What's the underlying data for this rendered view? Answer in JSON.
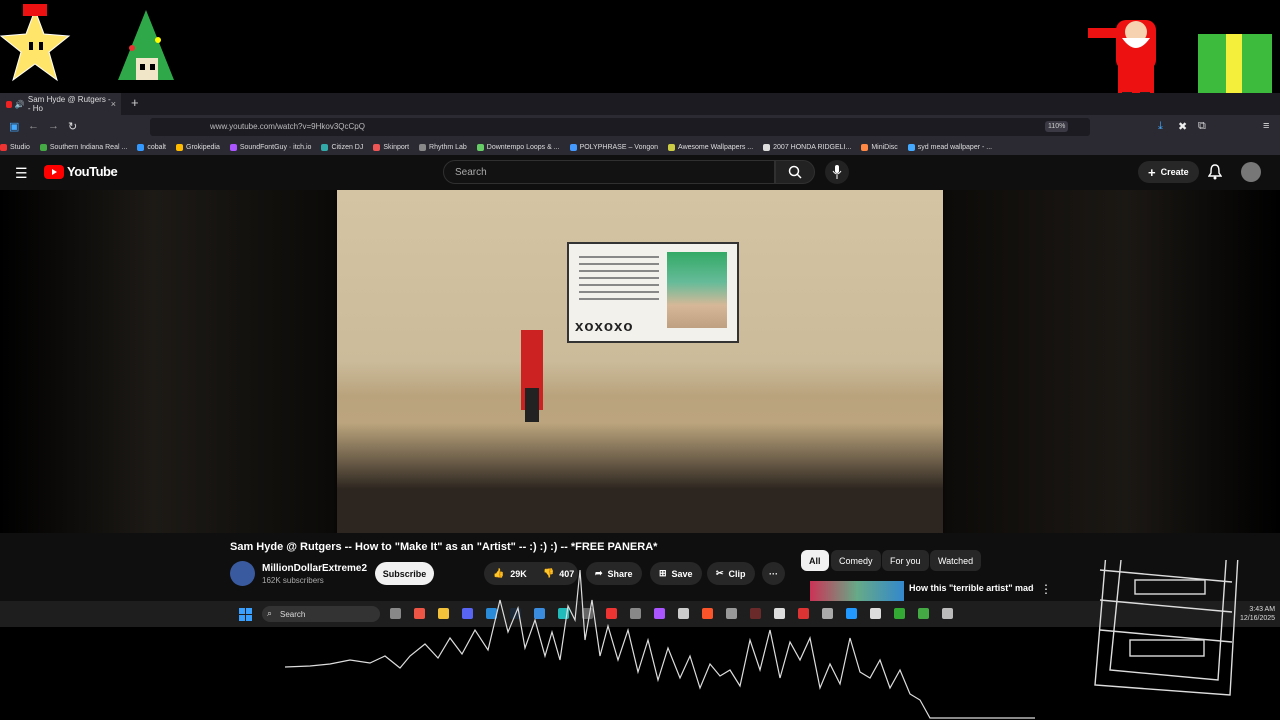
{
  "browser": {
    "tab_title": "Sam Hyde @ Rutgers -- Ho",
    "tab_close": "×",
    "new_tab": "+",
    "url": "www.youtube.com/watch?v=9Hkov3QcCpQ",
    "zoom": "110%",
    "bookmarks": [
      "Studio",
      "Southern Indiana Real ...",
      "cobalt",
      "Grokipedia",
      "SoundFontGuy · itch.io",
      "Citizen DJ",
      "Skinport",
      "Rhythm Lab",
      "Downtempo Loops & ...",
      "POLYPHRASE – Vongon",
      "Awesome Wallpapers ...",
      "2007 HONDA RIDGELI...",
      "MiniDisc",
      "syd mead wallpaper - ..."
    ]
  },
  "youtube": {
    "logo_text": "YouTube",
    "search_placeholder": "Search",
    "create_label": "Create"
  },
  "video": {
    "screen_text": "xoxoxo",
    "title": "Sam Hyde @ Rutgers -- How to \"Make It\" as an \"Artist\" -- :) :) :) -- *FREE PANERA*",
    "channel": "MillionDollarExtreme2",
    "subscribers": "162K subscribers",
    "subscribe_label": "Subscribe",
    "likes": "29K",
    "dislikes": "407",
    "share_label": "Share",
    "save_label": "Save",
    "clip_label": "Clip",
    "more_label": "···"
  },
  "chips": [
    "All",
    "Comedy",
    "For you",
    "Watched"
  ],
  "recommendation": {
    "title": "How this \"terrible artist\" made MILLIONS"
  },
  "taskbar": {
    "search_label": "Search",
    "time": "3:43 AM",
    "date": "12/16/2025"
  }
}
